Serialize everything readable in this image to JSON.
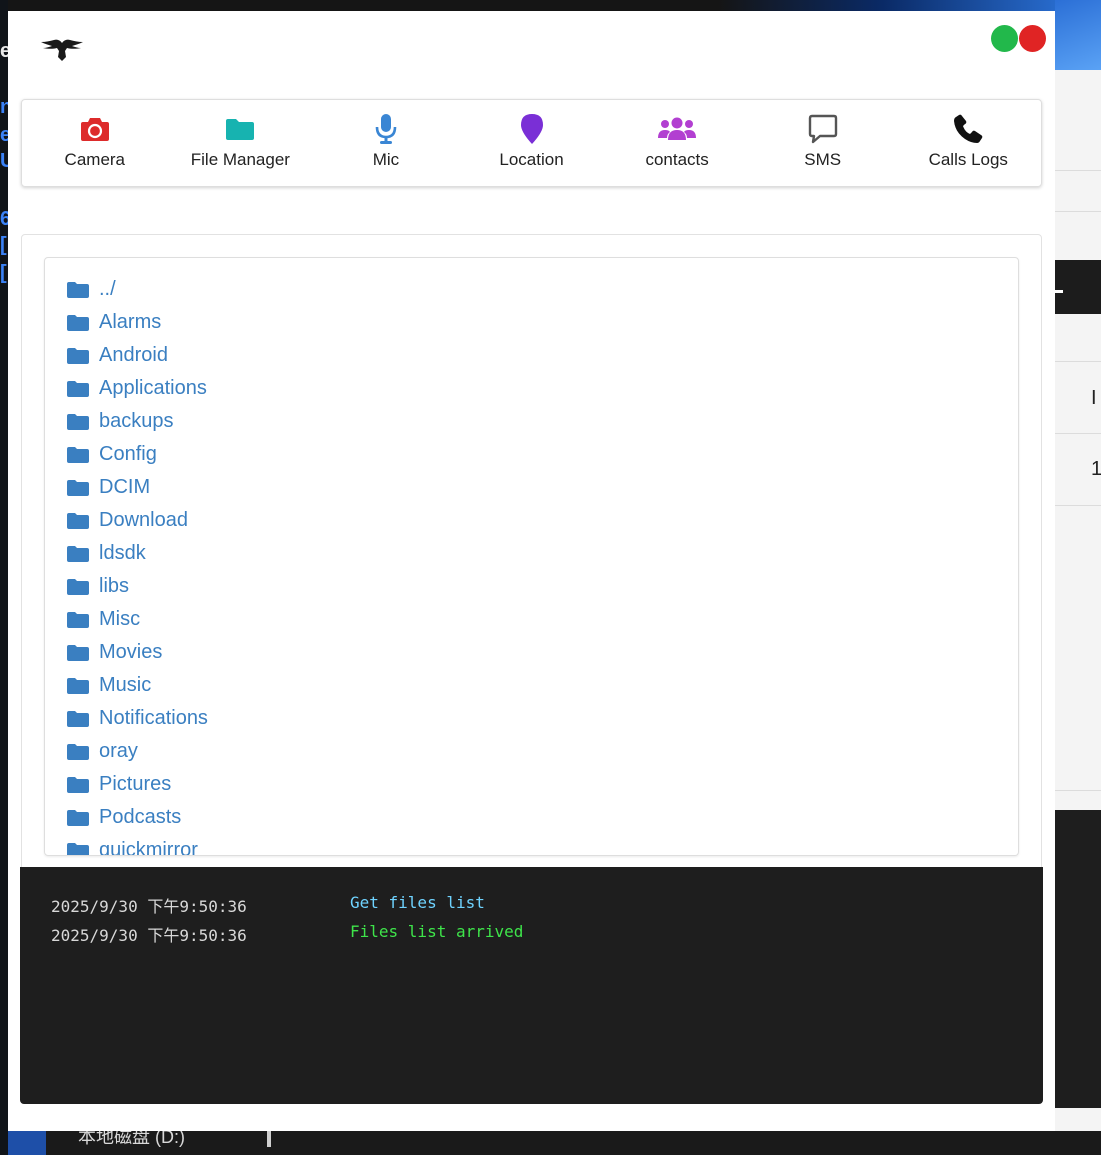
{
  "background": {
    "left_glyphs": [
      "e",
      "n",
      "e",
      "U",
      "6",
      "[",
      "["
    ],
    "right_header_text": "I",
    "right_row_text": "1",
    "taskbar_breadcrumb": "本地磁盘 (D:)"
  },
  "toolbar": {
    "items": [
      {
        "label": "Camera",
        "icon": "camera-icon",
        "color": "#dd2b2b"
      },
      {
        "label": "File Manager",
        "icon": "folder-icon",
        "color": "#17b3b0"
      },
      {
        "label": "Mic",
        "icon": "microphone-icon",
        "color": "#3a86d4"
      },
      {
        "label": "Location",
        "icon": "map-marker-icon",
        "color": "#7a2fd6"
      },
      {
        "label": "contacts",
        "icon": "users-icon",
        "color": "#b23fd1"
      },
      {
        "label": "SMS",
        "icon": "comment-icon",
        "color": "#555555"
      },
      {
        "label": "Calls Logs",
        "icon": "phone-icon",
        "color": "#111111"
      }
    ]
  },
  "files": [
    "../",
    "Alarms",
    "Android",
    "Applications",
    "backups",
    "Config",
    "DCIM",
    "Download",
    "ldsdk",
    "libs",
    "Misc",
    "Movies",
    "Music",
    "Notifications",
    "oray",
    "Pictures",
    "Podcasts",
    "quickmirror"
  ],
  "console": {
    "lines": [
      {
        "time": "2025/9/30 下午9:50:36",
        "message": "Get files list",
        "color": "cyan"
      },
      {
        "time": "2025/9/30 下午9:50:36",
        "message": "Files list arrived",
        "color": "green"
      }
    ]
  },
  "colors": {
    "folder": "#3a7fc1",
    "status_green": "#22b84b",
    "status_red": "#e02424",
    "console_bg": "#1e1e1e"
  }
}
